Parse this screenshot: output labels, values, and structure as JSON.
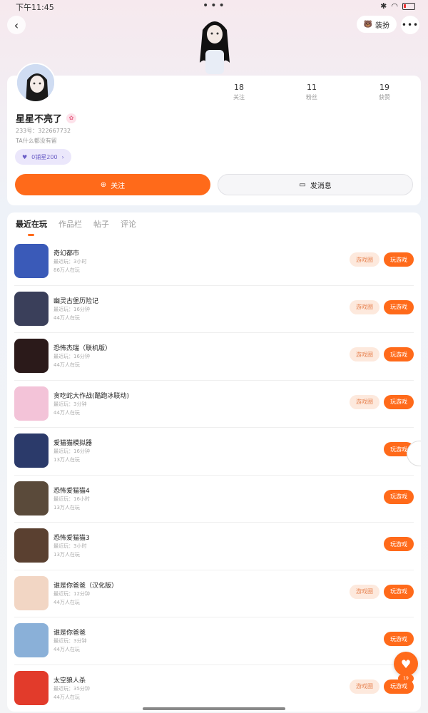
{
  "status": {
    "time": "下午11:45",
    "dots": "•••"
  },
  "header": {
    "dress_label": "装扮",
    "more": "•••"
  },
  "profile": {
    "stats": [
      {
        "value": "18",
        "label": "关注"
      },
      {
        "value": "11",
        "label": "粉丝"
      },
      {
        "value": "19",
        "label": "获赞"
      }
    ],
    "nickname": "星星不亮了",
    "uid": "233号：322667732",
    "bio": "TA什么都没有留",
    "tag": "0铺星200",
    "follow_label": "关注",
    "message_label": "发消息"
  },
  "tabs": [
    "最近在玩",
    "作品栏",
    "帖子",
    "评论"
  ],
  "games": [
    {
      "name": "奇幻都市",
      "meta1": "最近玩：3小时",
      "meta2": "86万人在玩",
      "circle": "游戏圈",
      "play": "玩游戏",
      "has_circle": true
    },
    {
      "name": "幽灵古堡历险记",
      "meta1": "最近玩：16分钟",
      "meta2": "44万人在玩",
      "circle": "游戏圈",
      "play": "玩游戏",
      "has_circle": true
    },
    {
      "name": "恐怖杰瑞（联机版）",
      "meta1": "最近玩：16分钟",
      "meta2": "44万人在玩",
      "circle": "游戏圈",
      "play": "玩游戏",
      "has_circle": true
    },
    {
      "name": "贪吃蛇大作战(酷跑冰联动)",
      "meta1": "最近玩：3分钟",
      "meta2": "44万人在玩",
      "circle": "游戏圈",
      "play": "玩游戏",
      "has_circle": true
    },
    {
      "name": "爱猫猫模拟器",
      "meta1": "最近玩：16分钟",
      "meta2": "13万人在玩",
      "circle": "",
      "play": "玩游戏",
      "has_circle": false
    },
    {
      "name": "恐怖爱猫猫4",
      "meta1": "最近玩：16小时",
      "meta2": "13万人在玩",
      "circle": "",
      "play": "玩游戏",
      "has_circle": false
    },
    {
      "name": "恐怖爱猫猫3",
      "meta1": "最近玩：3小时",
      "meta2": "13万人在玩",
      "circle": "",
      "play": "玩游戏",
      "has_circle": false
    },
    {
      "name": "谁是你爸爸（汉化版）",
      "meta1": "最近玩：12分钟",
      "meta2": "44万人在玩",
      "circle": "游戏圈",
      "play": "玩游戏",
      "has_circle": true
    },
    {
      "name": "谁是你爸爸",
      "meta1": "最近玩：3分钟",
      "meta2": "44万人在玩",
      "circle": "",
      "play": "玩游戏",
      "has_circle": false
    },
    {
      "name": "太空狼人杀",
      "meta1": "最近玩：35分钟",
      "meta2": "44万人在玩",
      "circle": "游戏圈",
      "play": "玩游戏",
      "has_circle": true
    }
  ],
  "fab": {
    "count": "19"
  },
  "icon_colors": [
    "#3a5ab8",
    "#3a3f5a",
    "#2b1a1a",
    "#f3c3d8",
    "#2b3a6a",
    "#5a4a3a",
    "#5a4030",
    "#f2d6c4",
    "#8ab0d8",
    "#e23b2b"
  ]
}
